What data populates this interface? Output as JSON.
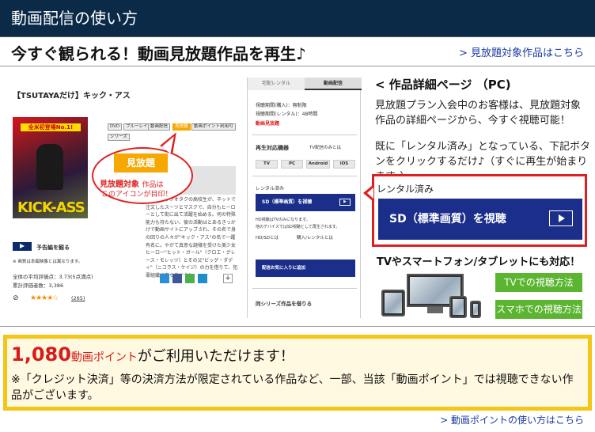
{
  "header": {
    "title": "動画配信の使い方"
  },
  "subheader": {
    "title": "今すぐ観られる！動画見放題作品を再生♪",
    "link": "> 見放題対象作品はこちら"
  },
  "screenshot": {
    "product_title": "【TSUTAYAだけ】キック・アス",
    "poster_banner": "全米初登場No.1!",
    "poster_title": "KICK-ASS",
    "tags": [
      "DVD",
      "ブルーレイ",
      "動画配信",
      "見放題",
      "動画ポイント利用可",
      "シリーズ"
    ],
    "trailer_label": "予告編を観る",
    "note": "※ 画質は本編映像とは異なります。",
    "avg_rating": "全体の平均評価点：3.73(5点満点)",
    "rating_count": "累計評価者数：3,386",
    "review_count": "(265)",
    "description": "は、コミックオタクの高校生が、ネットで注文したスーツとマスクで、自分もヒーローとして街に出て活躍を始める。何の特殊能力も持たない、彼の活動はとあるきっかけで動画サイトにアップされ、その名で身の回りの人々が\"キック・アス\"の名で一躍有名に。やがて真意な謎様を受けた美少女ヒーロー\"ヒット・ガール\"（クロエ・グレース・モレッツ）とその父\"ビッグ・ダディ\"（ニコラス・ケイジ）の力を借りて、犯罪組織に立ち向かう！",
    "bubble_button": "見放題",
    "bubble_line1": "見放題対象",
    "bubble_line1b": "作品は",
    "bubble_line2": "このアイコンが目印！",
    "right_tab_rental": "宅配レンタル",
    "right_tab_stream": "動画配信",
    "period_buy": "視聴期間(購入)：無制限",
    "period_rental": "視聴期間(レンタル)：48時間",
    "stream_mihodai": "動画見放題",
    "devices_label": "再生対応機器",
    "tv_link": "TV配信のみとは",
    "device_boxes": [
      "TV",
      "PC",
      "Android",
      "iOS"
    ],
    "rental_label": "レンタル済み",
    "sd_button": "SD（標準画質）を視聴",
    "hd_note1": "HD視聴はTVのみになります。",
    "hd_note2": "他のデバイスではSD視聴として再生されます。",
    "hd_sd_label": "HD/SDとは",
    "buy_rental": "購入/レンタルとは",
    "favorite_button": "配信お気に入りに追加",
    "series_label": "同シリーズ作品を借りる"
  },
  "pc_section": {
    "title": "< 作品詳細ページ （PC)",
    "para1": "見放題プラン入会中のお客様は、見放題対象作品の詳細ページから、今すぐ視聴可能！",
    "para2": "既に「レンタル済み」となっている、下記ボタンをクリックするだけ♪（すぐに再生が始まります。）",
    "rental_label": "レンタル済み",
    "sd_button": "SD（標準画質）を視聴"
  },
  "devices": {
    "title": "TVやスマートフォン/タブレットにも対応！",
    "tv_button": "TVでの視聴方法",
    "phone_button": "スマホでの視聴方法"
  },
  "points": {
    "amount": "1,080",
    "unit": "動画ポイント",
    "suffix": "がご利用いただけます！",
    "note": "※「クレジット決済」等の決済方法が限定されている作品など、一部、当該「動画ポイント」では視聴できない作品がございます。",
    "link": "> 動画ポイントの使い方はこちら"
  },
  "colors": {
    "header_bg": "#0a2a48",
    "accent_red": "#e02020",
    "button_blue": "#1a2e8a",
    "button_green": "#5cb531",
    "highlight_yellow": "#f5c518",
    "tag_orange": "#f6a800"
  }
}
